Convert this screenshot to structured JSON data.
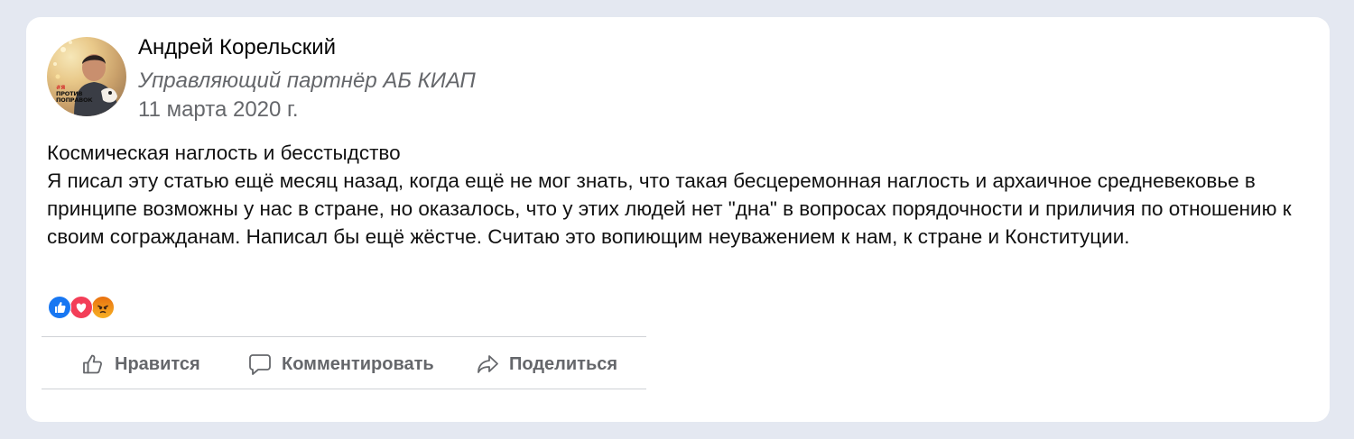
{
  "post": {
    "author": {
      "name": "Андрей Корельский",
      "role": "Управляющий партнёр АБ КИАП",
      "avatar_badge": [
        "#Я",
        "ПРОТИВ",
        "ПОПРАВОК"
      ]
    },
    "date": "11 марта 2020 г.",
    "title": "Космическая наглость и бесстыдство",
    "body": "Я писал эту статью ещё месяц назад, когда ещё не мог знать, что такая бесцеремонная наглость и архаичное средневековье в принципе возможны у нас в стране, но оказалось, что  у этих людей нет \"дна\" в вопросах порядочности и приличия по отношению к своим согражданам. Написал бы ещё жёстче. Считаю это вопиющим неуважением к нам, к стране и Конституции.",
    "reactions": [
      "like-icon",
      "love-icon",
      "angry-icon"
    ]
  },
  "actions": {
    "like_label": "Нравится",
    "comment_label": "Комментировать",
    "share_label": "Поделиться"
  },
  "colors": {
    "page_bg": "#e4e8f1",
    "card_bg": "#ffffff",
    "secondary_text": "#65676b",
    "like_blue": "#1877f2",
    "love_red": "#f33e58",
    "angry_orange": "#e9710f"
  }
}
